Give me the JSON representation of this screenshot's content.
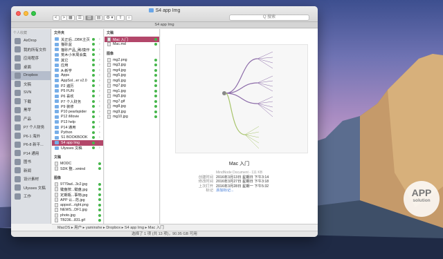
{
  "window": {
    "title": "S4 app Img",
    "path_tab": "S4 app Img",
    "search_placeholder": "Q 搜索"
  },
  "toolbar": {
    "back": "<",
    "fwd": ">",
    "view_icons": "▦",
    "view_list": "☰",
    "view_cols": "▥",
    "view_flow": "▤",
    "arrange": "⚙ ▾",
    "share": "⇧",
    "tags": "○"
  },
  "sidebar": {
    "heading": "个人收藏",
    "items": [
      {
        "label": "AirDrop"
      },
      {
        "label": "我的所有文件"
      },
      {
        "label": "应用程序"
      },
      {
        "label": "桌面"
      },
      {
        "label": "Dropbox",
        "selected": true
      },
      {
        "label": "文稿"
      },
      {
        "label": "SVN"
      },
      {
        "label": "下载"
      },
      {
        "label": "黑苹"
      },
      {
        "label": "产品"
      },
      {
        "label": "P7 个人财务"
      },
      {
        "label": "P6-1 海外"
      },
      {
        "label": "P6-8 新平..."
      },
      {
        "label": "P14 通用"
      },
      {
        "label": "图书"
      },
      {
        "label": "新闻"
      },
      {
        "label": "设计素材"
      },
      {
        "label": "Ulysses 文稿"
      },
      {
        "label": "工作"
      }
    ]
  },
  "column1": {
    "heading": "文件夹",
    "rows": [
      "关正后...DBK主页",
      "猫砂盆",
      "猫砂产品_刷/摸作",
      "荒木小米周会集",
      "其它",
      "应用",
      "A-新学",
      "Apps",
      "AppSol...er v2.0",
      "P2 遍历",
      "P5 FUN",
      "P6 喜欢",
      "P7 个人财务",
      "P9 装修",
      "P10 pearlspider",
      "P12 iMovie",
      "P13 help",
      "P14 通用",
      "Python",
      "S1 BOOKBOOK",
      "S4 app Img",
      "Ulysses 文稿"
    ],
    "selected": "S4 app Img",
    "heading2": "文稿",
    "rows2": [
      "MODC",
      "SDK 整...xmind"
    ],
    "heading3": "图像",
    "rows3": [
      "9779ad...3c2.jpg",
      "键盘按...键盘.jpg",
      "定期瓶...事物.jpg",
      "APP 认...范.jpg",
      "appsol...right.png",
      "NEWS...DF1.jpg",
      "photo.jpg",
      "TB236...831.gif"
    ]
  },
  "column2": {
    "heading": "文稿",
    "rows": [
      "Mac 入门",
      "Mac.md"
    ],
    "selected": "Mac 入门",
    "heading2": "图像",
    "rows2": [
      "mg2.png",
      "mg3.jpg",
      "mg4.jpg",
      "mg5.jpg",
      "mg6.jpg",
      "mg7.jpg",
      "mg1.jpg",
      "mg5.jpg",
      "mg7.gif",
      "mg8.jpg",
      "mg9.jpg",
      "mg10.jpg"
    ]
  },
  "preview": {
    "title": "Mac 入门",
    "subtitle": "MindNode Document - 111 KB",
    "meta": [
      {
        "k": "创建时间",
        "v": "2016年3月13日 星期日 下午3:14"
      },
      {
        "k": "修改时间",
        "v": "2016年3月27日 星期日 下午3:18"
      },
      {
        "k": "上次打开",
        "v": "2016年3月28日 星期一 下午5:32"
      },
      {
        "k": "标记",
        "v": "添加标记..."
      }
    ]
  },
  "pathbar": "MacOS ▸ 用户 ▸ yaminshe ▸ Dropbox ▸ S4 app Img ▸ Mac 入门",
  "statusbar": "选择了 1 项 (共 13 项)，90.95 GB 可用",
  "badge": {
    "line1": "APP",
    "line2": "solution"
  }
}
